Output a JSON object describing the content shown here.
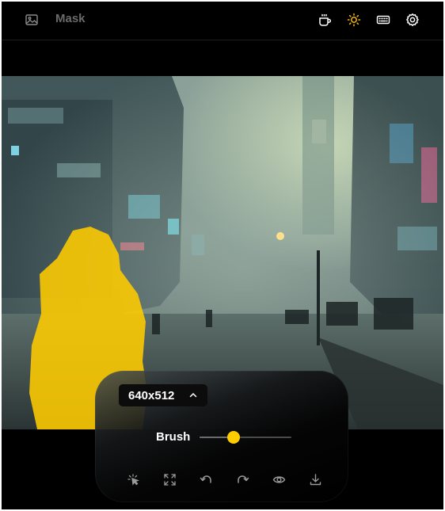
{
  "header": {
    "mode_label": "Mask",
    "icons": [
      "image-icon",
      "coffee-icon",
      "sun-icon",
      "keyboard-icon",
      "settings-icon"
    ],
    "accent_color": "#f5b700"
  },
  "toolbar": {
    "resolution": "640x512",
    "brush_label": "Brush",
    "brush_size_fraction": 0.37,
    "slider_thumb_color": "#ffcc00",
    "tools": [
      "interactive-seg-icon",
      "fit-to-screen-icon",
      "undo-icon",
      "redo-icon",
      "show-original-icon",
      "download-icon"
    ]
  },
  "canvas": {
    "mask_color": "#ffcc00"
  }
}
